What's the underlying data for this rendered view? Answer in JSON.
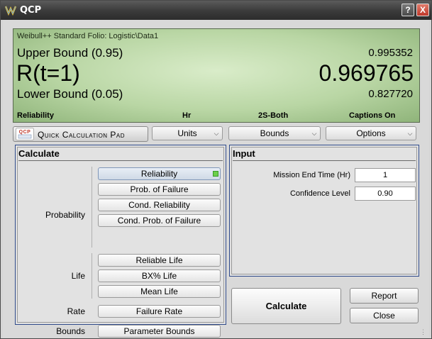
{
  "window": {
    "title": "QCP",
    "help_label": "?",
    "close_label": "X"
  },
  "display": {
    "folio": "Weibull++ Standard Folio: Logistic\\Data1",
    "upper_label": "Upper Bound (0.95)",
    "upper_value": "0.995352",
    "main_label": "R(t=1)",
    "main_value": "0.969765",
    "lower_label": "Lower Bound (0.05)",
    "lower_value": "0.827720",
    "status": [
      "Reliability",
      "Hr",
      "2S-Both",
      "Captions On"
    ]
  },
  "toolbar": {
    "qcp_logo": "QCP",
    "qcp_label": "Quick Calculation Pad",
    "units_label": "Units",
    "bounds_label": "Bounds",
    "options_label": "Options"
  },
  "calculate": {
    "title": "Calculate",
    "groups": {
      "probability": "Probability",
      "life": "Life",
      "rate": "Rate",
      "bounds": "Bounds"
    },
    "buttons": {
      "reliability": "Reliability",
      "prob_failure": "Prob. of Failure",
      "cond_reliability": "Cond. Reliability",
      "cond_prob_failure": "Cond. Prob. of Failure",
      "reliable_life": "Reliable Life",
      "bx_life": "BX% Life",
      "mean_life": "Mean Life",
      "failure_rate": "Failure Rate",
      "parameter_bounds": "Parameter Bounds"
    }
  },
  "input": {
    "title": "Input",
    "mission_label": "Mission End Time (Hr)",
    "mission_value": "1",
    "confidence_label": "Confidence Level",
    "confidence_value": "0.90"
  },
  "actions": {
    "calculate": "Calculate",
    "report": "Report",
    "close": "Close"
  },
  "colors": {
    "display_green": "#b9d6a4",
    "panel_border": "#2f4a8a",
    "indicator": "#6bcf4a"
  }
}
